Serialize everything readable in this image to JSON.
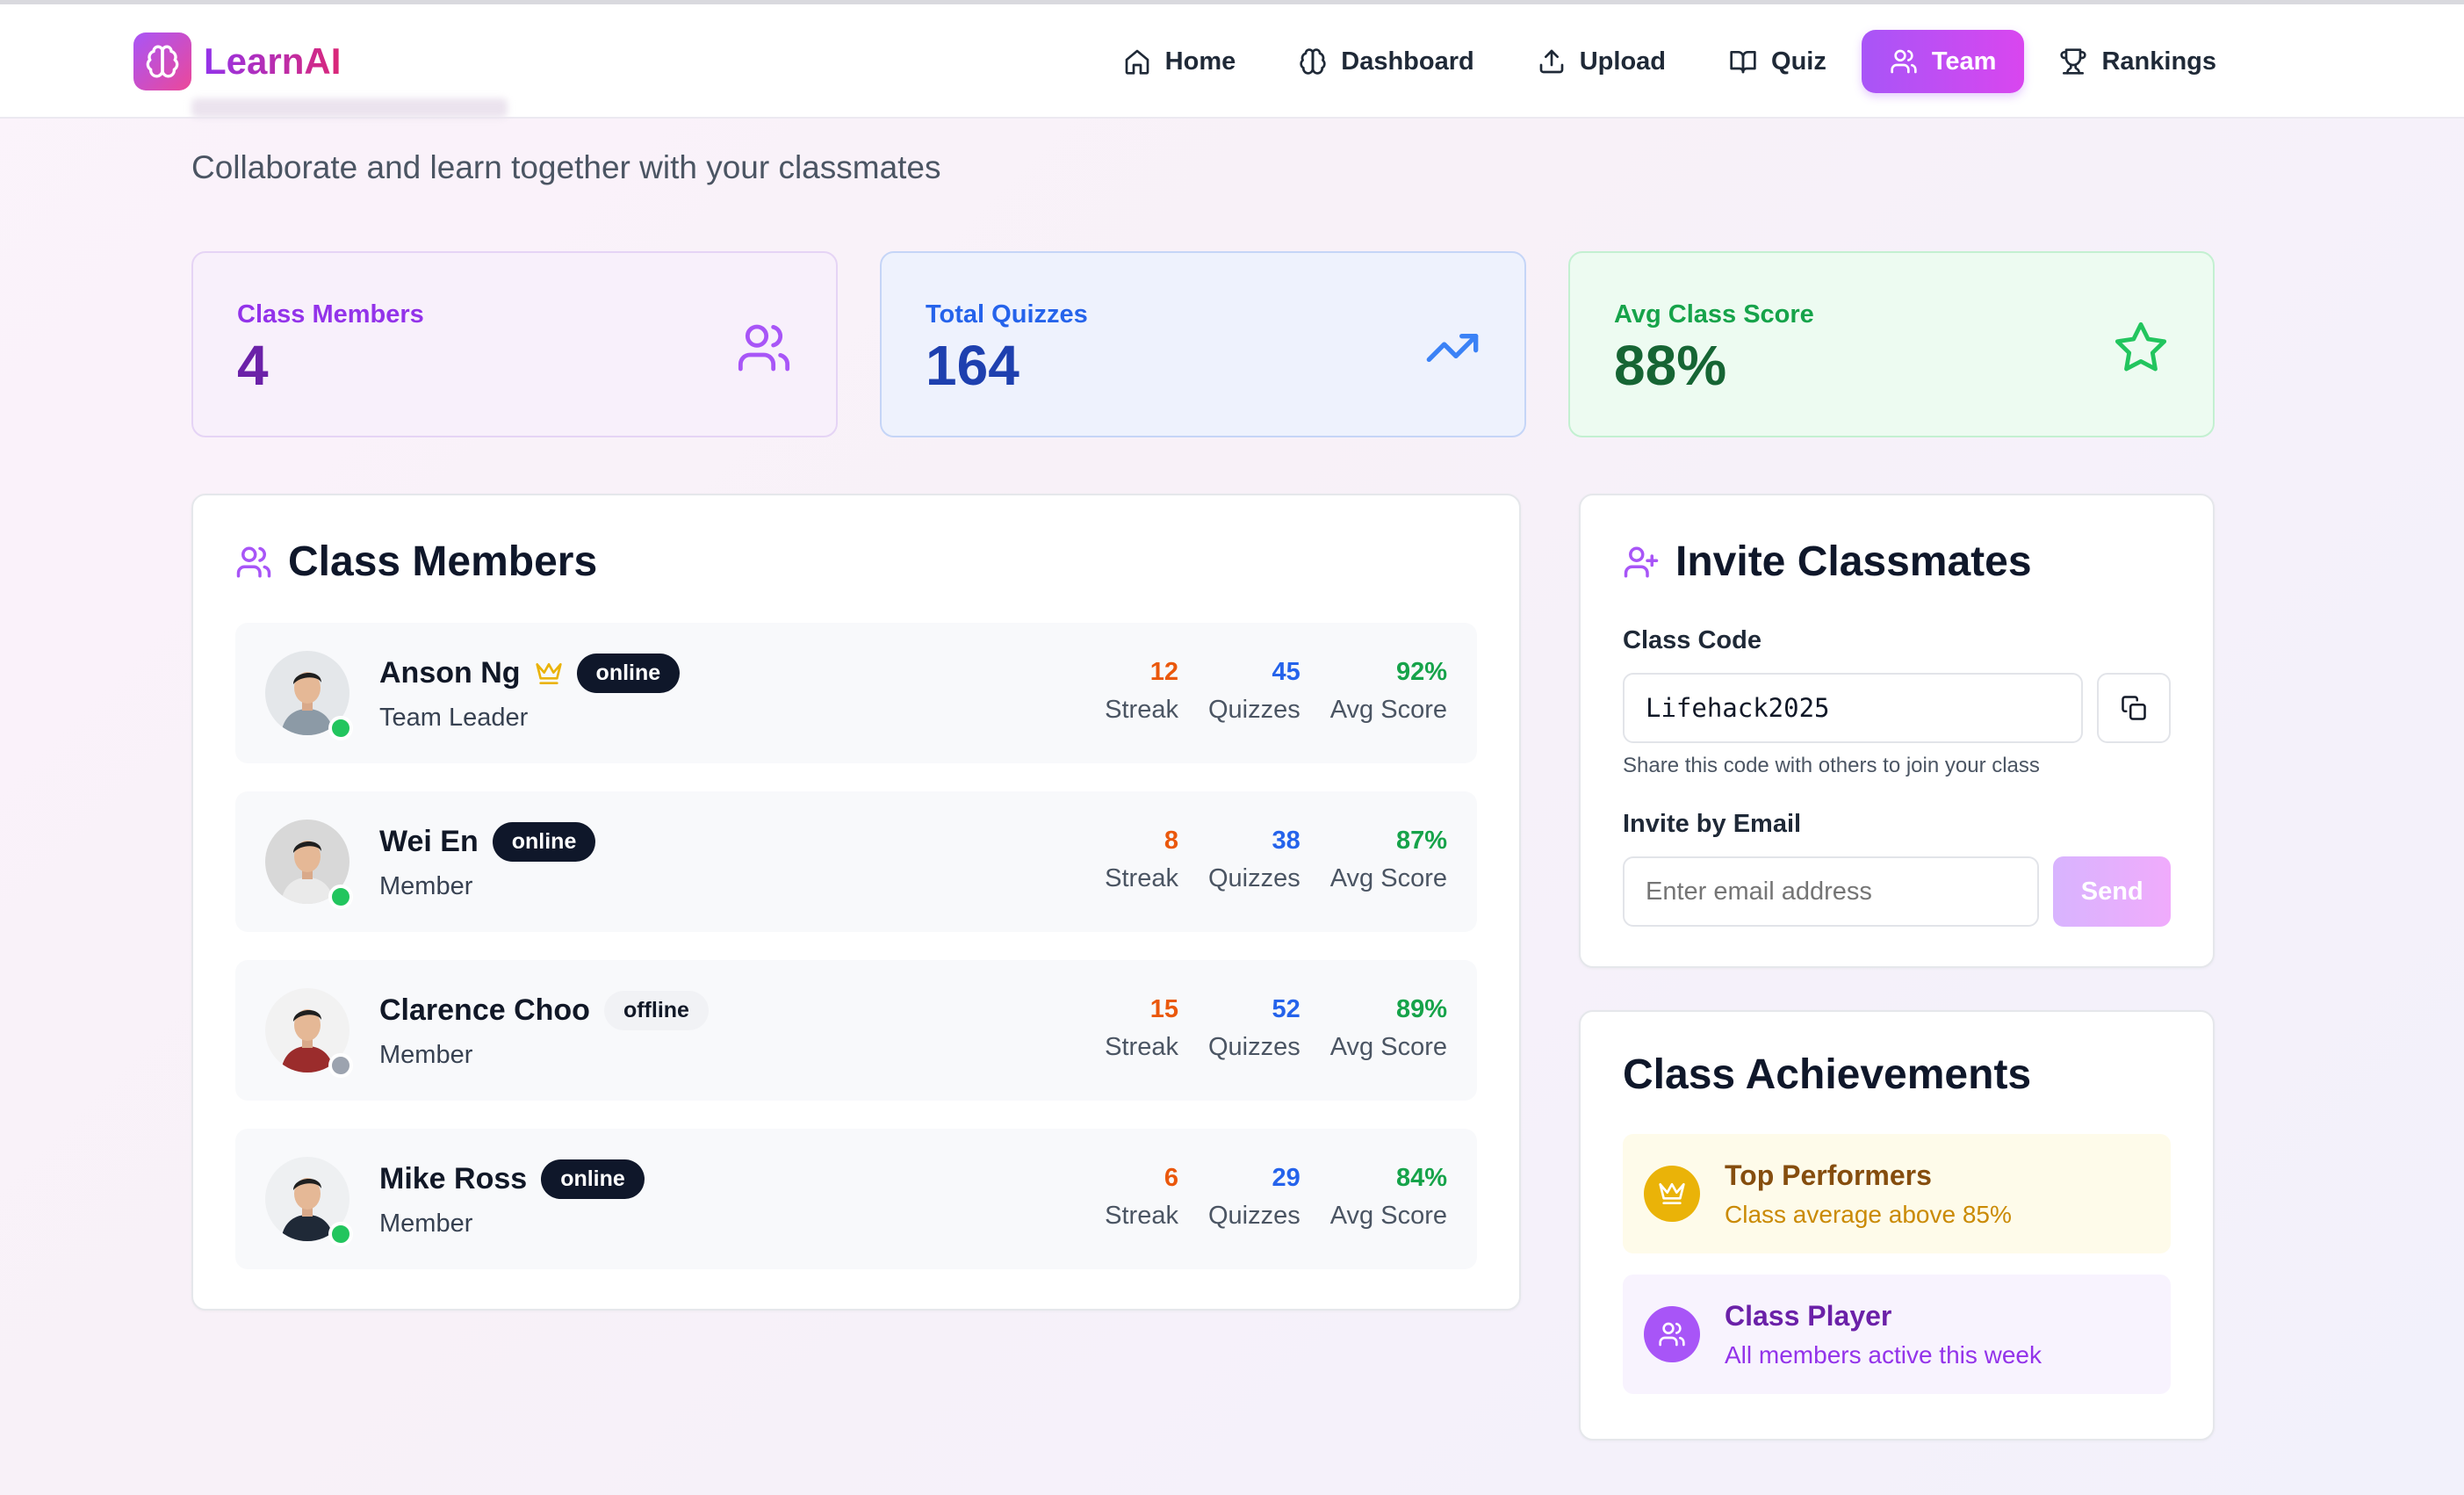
{
  "app": {
    "name": "LearnAI"
  },
  "nav": [
    {
      "label": "Home",
      "icon": "home-icon",
      "active": false
    },
    {
      "label": "Dashboard",
      "icon": "brain-icon",
      "active": false
    },
    {
      "label": "Upload",
      "icon": "upload-icon",
      "active": false
    },
    {
      "label": "Quiz",
      "icon": "book-icon",
      "active": false
    },
    {
      "label": "Team",
      "icon": "users-icon",
      "active": true
    },
    {
      "label": "Rankings",
      "icon": "trophy-icon",
      "active": false
    }
  ],
  "page": {
    "subtitle": "Collaborate and learn together with your classmates"
  },
  "stats": {
    "members": {
      "label": "Class Members",
      "value": "4",
      "icon": "users-icon"
    },
    "quizzes": {
      "label": "Total Quizzes",
      "value": "164",
      "icon": "trending-up-icon"
    },
    "score": {
      "label": "Avg Class Score",
      "value": "88%",
      "icon": "star-icon"
    }
  },
  "members_panel": {
    "title": "Class Members",
    "stat_labels": {
      "streak": "Streak",
      "quizzes": "Quizzes",
      "avg": "Avg Score"
    },
    "members": [
      {
        "name": "Anson Ng",
        "role": "Team Leader",
        "status": "online",
        "leader": true,
        "streak": "12",
        "quizzes": "45",
        "avg": "92%",
        "shirt": "#8c9aa6",
        "bg": "#e4e7ea"
      },
      {
        "name": "Wei En",
        "role": "Member",
        "status": "online",
        "leader": false,
        "streak": "8",
        "quizzes": "38",
        "avg": "87%",
        "shirt": "#eaeaea",
        "bg": "#d8d8d8"
      },
      {
        "name": "Clarence Choo",
        "role": "Member",
        "status": "offline",
        "leader": false,
        "streak": "15",
        "quizzes": "52",
        "avg": "89%",
        "shirt": "#9b2c2c",
        "bg": "#f2f2f2"
      },
      {
        "name": "Mike Ross",
        "role": "Member",
        "status": "online",
        "leader": false,
        "streak": "6",
        "quizzes": "29",
        "avg": "84%",
        "shirt": "#1f2937",
        "bg": "#eef0f2"
      }
    ]
  },
  "invite": {
    "title": "Invite Classmates",
    "code_label": "Class Code",
    "code_value": "Lifehack2025",
    "helper": "Share this code with others to join your class",
    "email_label": "Invite by Email",
    "email_placeholder": "Enter email address",
    "send_label": "Send"
  },
  "achievements": {
    "title": "Class Achievements",
    "items": [
      {
        "title": "Top Performers",
        "desc": "Class average above 85%",
        "icon": "crown-icon",
        "tone": "yellow"
      },
      {
        "title": "Class Player",
        "desc": "All members active this week",
        "icon": "users-icon",
        "tone": "purple"
      }
    ]
  },
  "colors": {
    "accent": "#a855f7",
    "online": "#22c55e",
    "offline": "#9ca3af",
    "streak": "#ea580c",
    "quizzes": "#2563eb",
    "avg": "#16a34a"
  }
}
